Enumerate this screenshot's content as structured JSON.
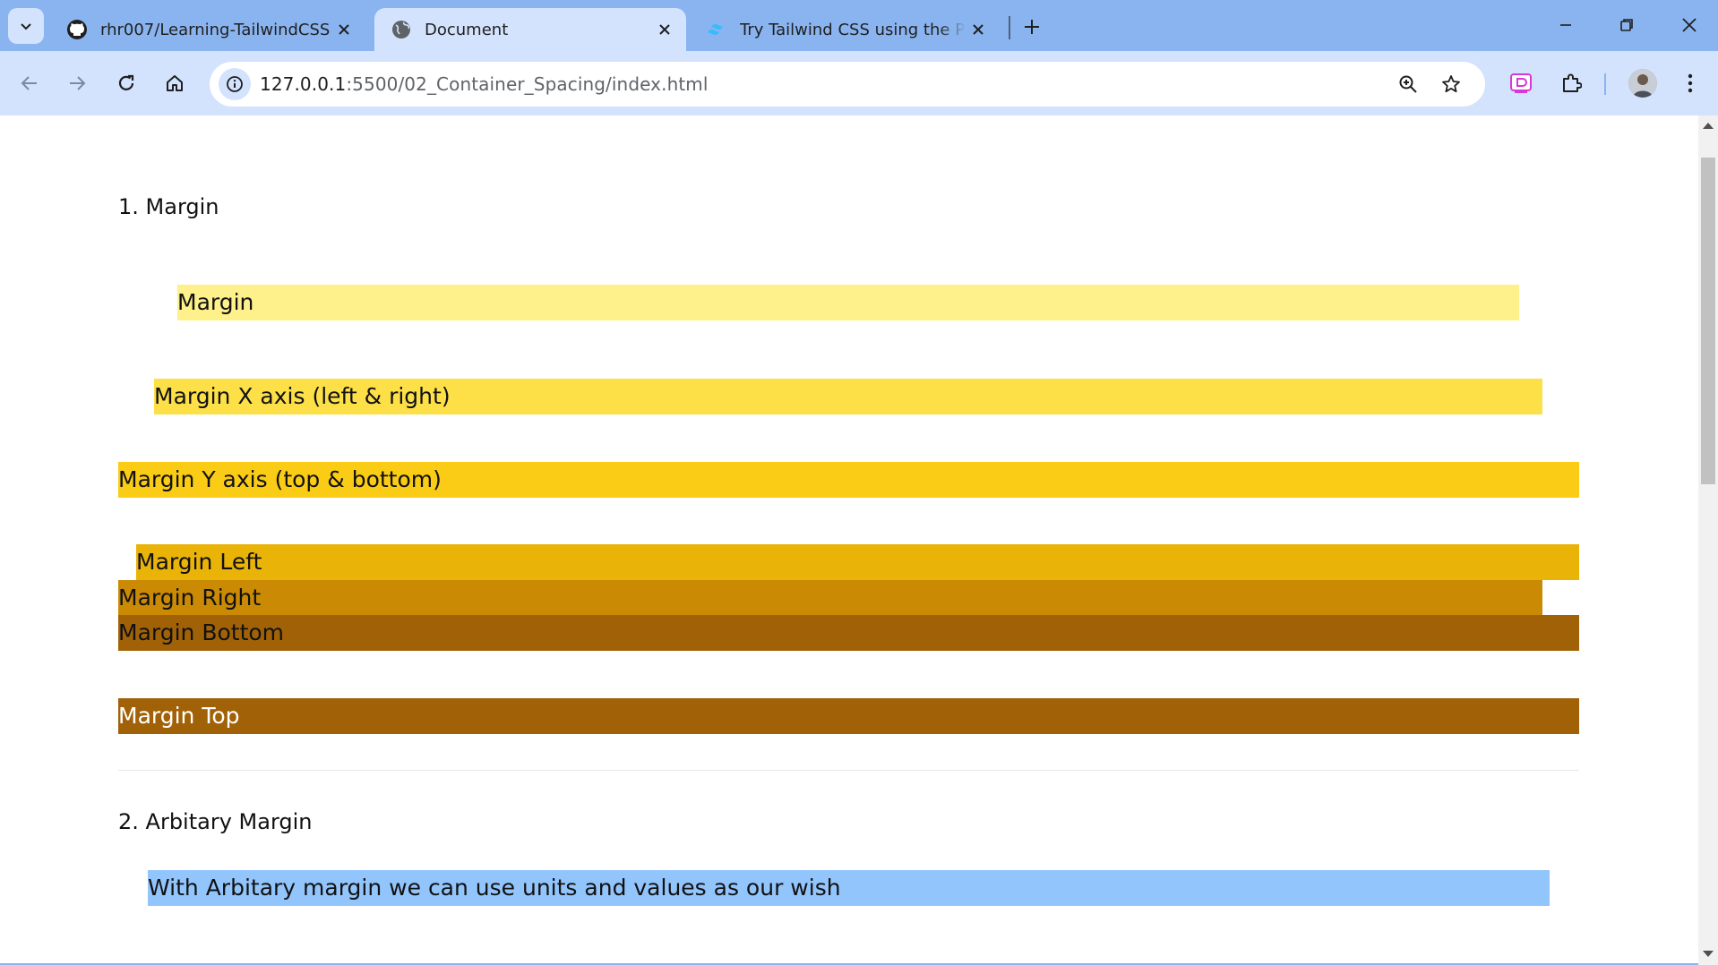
{
  "browser": {
    "tabs": [
      {
        "title": "rhr007/Learning-TailwindCSS",
        "icon": "github-icon",
        "active": false
      },
      {
        "title": "Document",
        "icon": "globe-icon",
        "active": true
      },
      {
        "title": "Try Tailwind CSS using the Play CDN",
        "icon": "tailwind-icon",
        "active": false
      }
    ],
    "url_host": "127.0.0.1",
    "url_path": ":5500/02_Container_Spacing/index.html",
    "colors": {
      "tabstrip": "#8ab4f0",
      "toolbar": "#d3e3fd"
    }
  },
  "page": {
    "section1_heading": "1. Margin",
    "section1_bars": [
      {
        "label": "Margin",
        "color": "#fef08a"
      },
      {
        "label": "Margin X axis (left & right)",
        "color": "#fde047"
      },
      {
        "label": "Margin Y axis (top & bottom)",
        "color": "#facc15"
      },
      {
        "label": "Margin Left",
        "color": "#eab308"
      },
      {
        "label": "Margin Right",
        "color": "#ca8a04"
      },
      {
        "label": "Margin Bottom",
        "color": "#a16207"
      },
      {
        "label": "Margin Top",
        "color": "#a16207",
        "text_color": "#ffffff"
      }
    ],
    "section2_heading": "2. Arbitary Margin",
    "section2_bar": {
      "label": "With Arbitary margin we can use units and values as our wish",
      "color": "#93c5fd"
    }
  }
}
